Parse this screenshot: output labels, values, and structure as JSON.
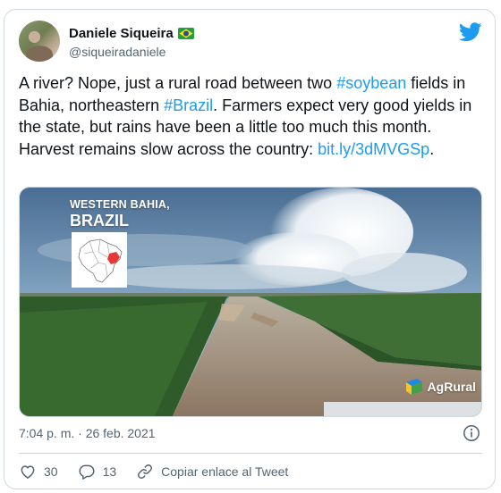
{
  "author": {
    "display_name": "Daniele Siqueira",
    "handle": "@siqueiradaniele",
    "flag_icon": "brazil-flag-icon"
  },
  "tweet": {
    "text_parts": [
      "A river? Nope, just a rural road between two ",
      "#soybean",
      " fields in Bahia, northeastern ",
      "#Brazil",
      ". Farmers expect very good yields in the state, but rains have been a little too much this month. Harvest remains slow across the country: ",
      "bit.ly/3dMVGSp",
      "."
    ]
  },
  "media": {
    "location_line1": "WESTERN BAHIA,",
    "location_line2": "BRAZIL",
    "brand": "AgRural"
  },
  "meta": {
    "timestamp": "7:04 p. m. · 26 feb. 2021"
  },
  "actions": {
    "likes": "30",
    "replies": "13",
    "copy_link": "Copiar enlace al Tweet"
  },
  "colors": {
    "link": "#1d9bf0",
    "twitter_blue": "#1d9bf0",
    "muted": "#536471"
  }
}
